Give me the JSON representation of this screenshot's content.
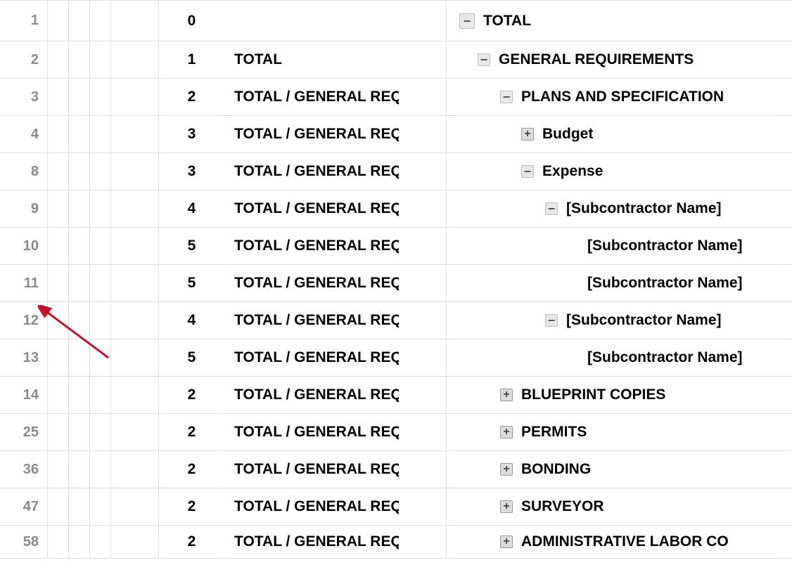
{
  "header": {
    "level": "0",
    "desc": "TOTAL",
    "toggle": "minus"
  },
  "rows": [
    {
      "rownum": "1",
      "level": "0",
      "style": "r0",
      "height": "h-hdr",
      "path": "",
      "desc": "TOTAL",
      "indent": 0,
      "toggle": "minus",
      "togstyle": "light-big"
    },
    {
      "rownum": "2",
      "level": "1",
      "style": "r1",
      "height": "h-row",
      "path": "TOTAL",
      "desc": "GENERAL REQUIREMENTS",
      "indent": 1,
      "toggle": "minus",
      "togstyle": "light"
    },
    {
      "rownum": "3",
      "level": "2",
      "style": "grey-dark",
      "height": "h-row",
      "path": "TOTAL / GENERAL REQ",
      "desc": "PLANS AND SPECIFICATION",
      "indent": 2,
      "toggle": "minus",
      "togstyle": "light"
    },
    {
      "rownum": "4",
      "level": "3",
      "style": "grey-light",
      "height": "h-row",
      "path": "TOTAL / GENERAL REQ",
      "desc": "Budget",
      "indent": 3,
      "toggle": "plus",
      "togstyle": "dark"
    },
    {
      "rownum": "8",
      "level": "3",
      "style": "grey-light",
      "height": "h-row",
      "path": "TOTAL / GENERAL REQ",
      "desc": "Expense",
      "indent": 3,
      "toggle": "minus",
      "togstyle": "light"
    },
    {
      "rownum": "9",
      "level": "4",
      "style": "blue-sel",
      "height": "h-row",
      "path": "TOTAL / GENERAL REQ",
      "desc": "[Subcontractor Name]",
      "indent": 4,
      "toggle": "minus",
      "togstyle": "light"
    },
    {
      "rownum": "10",
      "level": "5",
      "style": "white",
      "height": "h-row",
      "path": "TOTAL / GENERAL REQ",
      "desc": "[Subcontractor Name]",
      "indent": 5,
      "toggle": "",
      "togstyle": ""
    },
    {
      "rownum": "11",
      "level": "5",
      "style": "white",
      "height": "h-row",
      "path": "TOTAL / GENERAL REQ",
      "desc": "[Subcontractor Name]",
      "indent": 5,
      "toggle": "",
      "togstyle": ""
    },
    {
      "rownum": "12",
      "level": "4",
      "style": "blue-sel",
      "height": "h-row",
      "path": "TOTAL / GENERAL REQ",
      "desc": "[Subcontractor Name]",
      "indent": 4,
      "toggle": "minus",
      "togstyle": "light"
    },
    {
      "rownum": "13",
      "level": "5",
      "style": "white",
      "height": "h-row",
      "path": "TOTAL / GENERAL REQ",
      "desc": "[Subcontractor Name]",
      "indent": 5,
      "toggle": "",
      "togstyle": ""
    },
    {
      "rownum": "14",
      "level": "2",
      "style": "grey-dark selected",
      "height": "h-row",
      "path": "TOTAL / GENERAL REQ",
      "desc": "BLUEPRINT COPIES",
      "indent": 2,
      "toggle": "plus",
      "togstyle": "dark"
    },
    {
      "rownum": "25",
      "level": "2",
      "style": "grey-dark",
      "height": "h-row",
      "path": "TOTAL / GENERAL REQ",
      "desc": "PERMITS",
      "indent": 2,
      "toggle": "plus",
      "togstyle": "dark"
    },
    {
      "rownum": "36",
      "level": "2",
      "style": "grey-dark",
      "height": "h-row",
      "path": "TOTAL / GENERAL REQ",
      "desc": "BONDING",
      "indent": 2,
      "toggle": "plus",
      "togstyle": "dark"
    },
    {
      "rownum": "47",
      "level": "2",
      "style": "grey-dark",
      "height": "h-row",
      "path": "TOTAL / GENERAL REQ",
      "desc": "SURVEYOR",
      "indent": 2,
      "toggle": "plus",
      "togstyle": "dark"
    },
    {
      "rownum": "58",
      "level": "2",
      "style": "grey-dark",
      "height": "h-last",
      "path": "TOTAL / GENERAL REQ",
      "desc": "ADMINISTRATIVE LABOR CO",
      "indent": 2,
      "toggle": "plus",
      "togstyle": "dark"
    }
  ]
}
